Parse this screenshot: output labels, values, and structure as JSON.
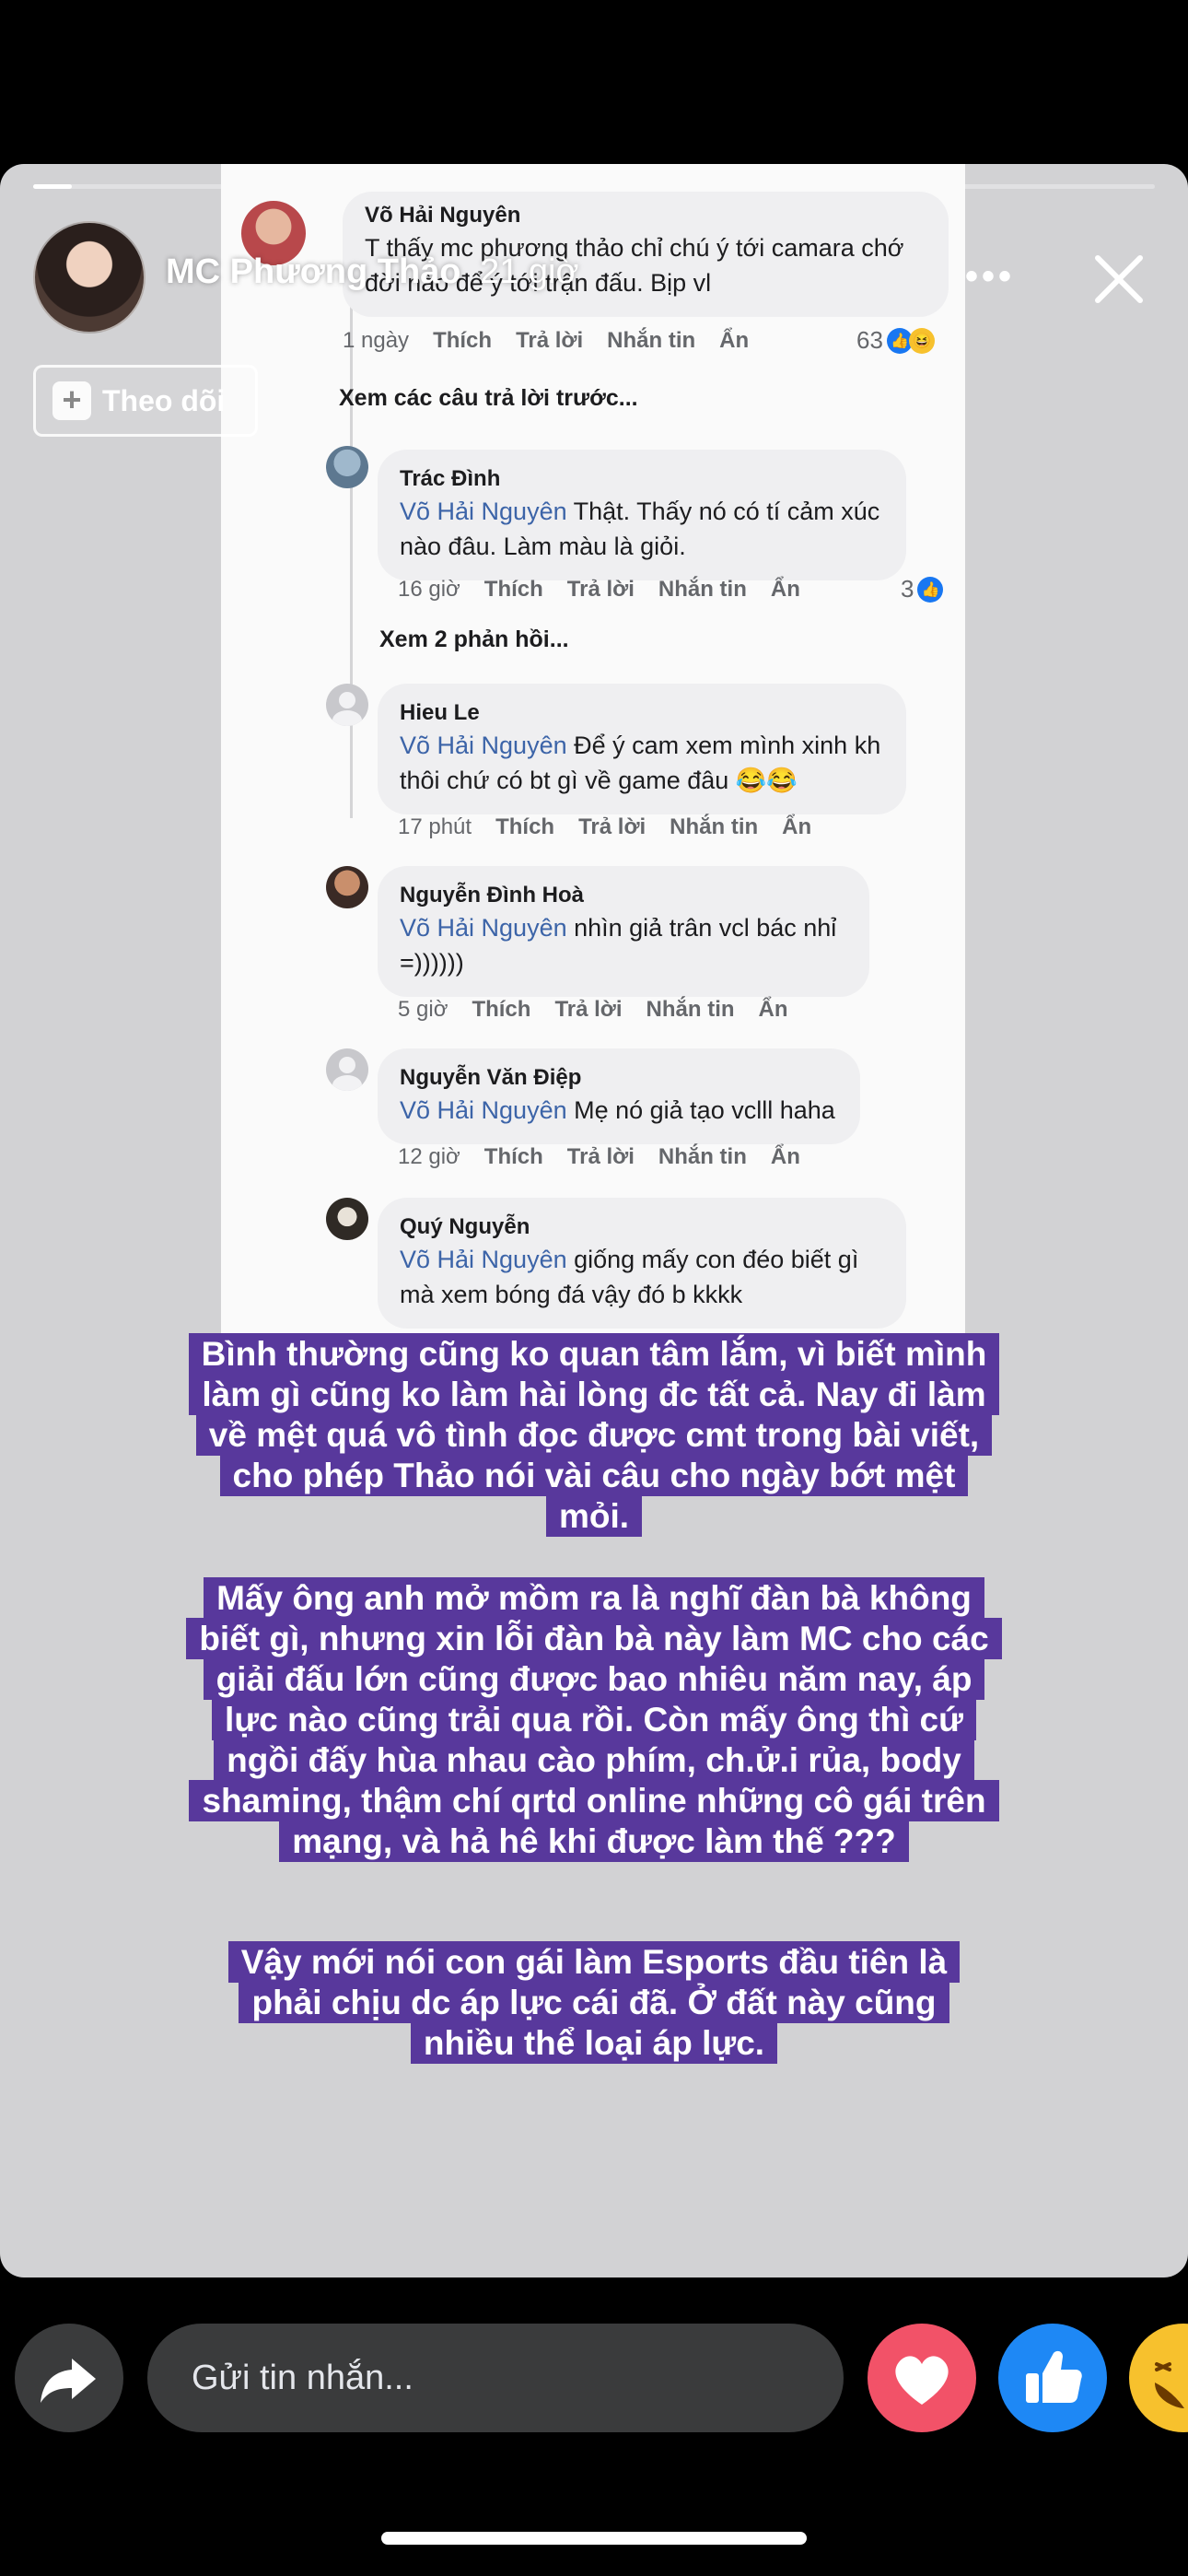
{
  "story": {
    "user_name": "MC Phương Thảo",
    "time": "21 giờ",
    "follow_label": "Theo dõi",
    "more_icon": "•••",
    "close_icon": "close-icon"
  },
  "screenshot": {
    "top_comment": {
      "name": "Võ Hải Nguyên",
      "text": "T thấy mc phương thảo chỉ chú ý tới camara chớ đời nào để ý tới trận đấu. Bịp vl",
      "time": "1 ngày",
      "reactions": "63"
    },
    "see_previous": "Xem các câu trả lời trước...",
    "replies": [
      {
        "name": "Trác Đình",
        "mention": "Võ Hải Nguyên",
        "text": " Thật. Thấy nó có tí cảm xúc nào đâu. Làm màu là giỏi.",
        "time": "16 giờ",
        "reactions": "3"
      },
      {
        "name": "Hieu Le",
        "mention": "Võ Hải Nguyên",
        "text": " Để ý cam xem mình xinh kh thôi chứ có bt gì về game đâu 😂😂",
        "time": "17 phút"
      },
      {
        "name": "Nguyễn Đình Hoà",
        "mention": "Võ Hải Nguyên",
        "text": " nhìn giả trân vcl bác nhỉ =))))))",
        "time": "5 giờ"
      },
      {
        "name": "Nguyễn Văn Điệp",
        "mention": "Võ Hải Nguyên",
        "text": " Mẹ nó giả tạo vclll haha",
        "time": "12 giờ"
      },
      {
        "name": "Quý Nguyễn",
        "mention": "Võ Hải Nguyên",
        "text": " giống mấy con đéo biết gì mà xem bóng đá vậy đó b kkkk"
      }
    ],
    "see_replies": "Xem 2 phản hồi...",
    "actions": {
      "like": "Thích",
      "reply": "Trả lời",
      "message": "Nhắn tin",
      "hide": "Ẩn"
    }
  },
  "captions": [
    "Bình thường cũng ko quan tâm lắm, vì biết mình làm gì cũng ko làm hài lòng đc tất cả. Nay đi làm về mệt quá vô tình đọc được cmt trong bài viết, cho phép Thảo nói vài câu cho ngày bớt mệt mỏi.",
    "Mấy ông anh mở mồm ra là nghĩ đàn bà không biết gì, nhưng xin lỗi đàn bà này làm MC cho các giải đấu lớn cũng được bao nhiêu năm nay, áp lực nào cũng trải qua rồi. Còn mấy ông thì cứ ngồi đấy hùa nhau cào phím, ch.ử.i rủa, body shaming, thậm chí qrtd online những cô gái trên mạng, và hả hê khi được làm thế ???",
    "Vậy mới nói con gái làm Esports đầu tiên là phải chịu dc áp lực cái đã. Ở đất này cũng nhiều thể loại áp lực."
  ],
  "bottom_bar": {
    "message_placeholder": "Gửi tin nhắn..."
  },
  "colors": {
    "caption_bg": "#58389c",
    "mention": "#3c64a8",
    "heart": "#f25268",
    "like": "#1e88f5"
  }
}
